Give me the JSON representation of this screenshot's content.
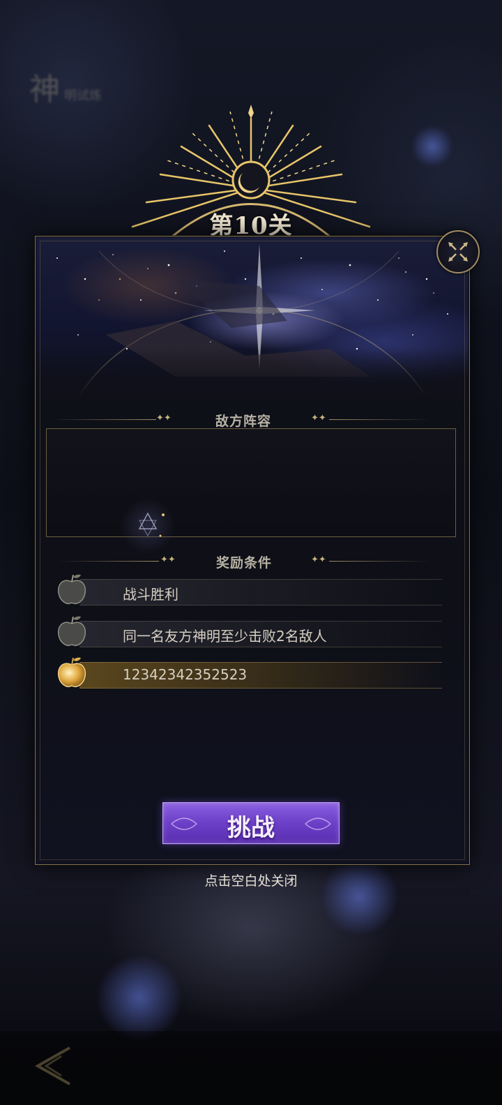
{
  "stage": {
    "title": "第10关"
  },
  "sections": {
    "enemy_lineup": "敌方阵容",
    "reward_conditions": "奖励条件"
  },
  "rewards": [
    {
      "text": "战斗胜利",
      "achieved": false
    },
    {
      "text": "同一名友方神明至少击败2名敌人",
      "achieved": false
    },
    {
      "text": "12342342352523",
      "achieved": true
    }
  ],
  "buttons": {
    "challenge": "挑战",
    "close_hint": "点击空白处关闭"
  },
  "background": {
    "menu_title": "神",
    "menu_title_small": "明试炼"
  },
  "icons": {
    "close": "close-x-icon",
    "apple_dim": "apple-icon",
    "apple_gold": "golden-apple-icon",
    "back": "back-arrow-icon"
  },
  "colors": {
    "gold": "#a18c62",
    "button_purple": "#6b3fc7",
    "panel_bg": "#0f1019"
  }
}
